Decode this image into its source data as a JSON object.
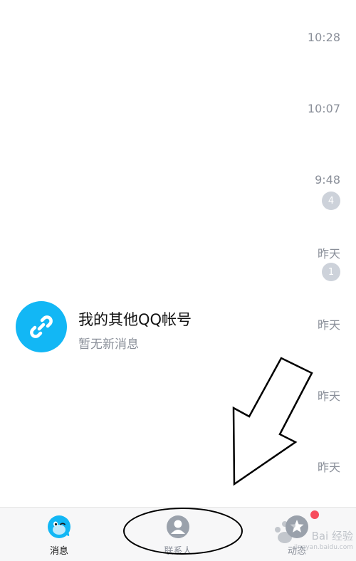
{
  "messages": [
    {
      "time": "10:28",
      "badge": ""
    },
    {
      "time": "10:07",
      "badge": ""
    },
    {
      "time": "9:48",
      "badge": "4"
    },
    {
      "time": "昨天",
      "badge": "1"
    },
    {
      "time": "昨天",
      "title": "我的其他QQ帐号",
      "subtitle": "暂无新消息",
      "avatar_icon": "link-icon"
    },
    {
      "time": "昨天",
      "badge": ""
    },
    {
      "time": "昨天",
      "badge": ""
    }
  ],
  "tabs": [
    {
      "label": "消息",
      "icon": "qq-penguin-icon"
    },
    {
      "label": "联系人",
      "icon": "contact-person-icon"
    },
    {
      "label": "动态",
      "icon": "star-planet-icon"
    }
  ],
  "watermark": {
    "text": "Bai 经验",
    "sub": "jingyan.baidu.com"
  },
  "colors": {
    "accent": "#12b7f5",
    "badge": "#cdd2da",
    "notification_dot": "#f74c5c"
  }
}
